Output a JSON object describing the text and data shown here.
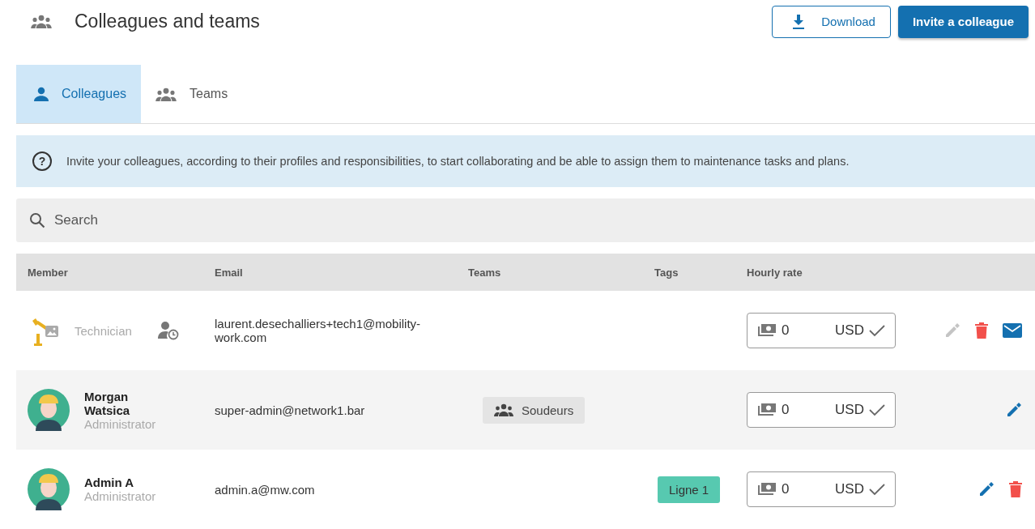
{
  "header": {
    "title": "Colleagues and teams",
    "download_button": "Download",
    "invite_button": "Invite a colleague"
  },
  "tabs": [
    {
      "label": "Colleagues",
      "kind": "person",
      "selected": true
    },
    {
      "label": "Teams",
      "kind": "group",
      "selected": false
    }
  ],
  "info_banner": {
    "icon": "?",
    "text": "Invite your colleagues, according to their profiles and responsibilities, to start collaborating and be able to assign them to maintenance tasks and plans."
  },
  "search": {
    "placeholder": "Search"
  },
  "table": {
    "columns": [
      "Member",
      "Email",
      "Teams",
      "Tags",
      "Hourly rate"
    ],
    "rows": [
      {
        "kind": "robot",
        "role": "Technician",
        "pending": true,
        "email": "laurent.desechalliers+tech1@mobility-work.com",
        "teams": [],
        "tags": [],
        "rate": "0",
        "currency": "USD",
        "actions": [
          {
            "kind": "edit",
            "disabled": true
          },
          {
            "kind": "delete"
          },
          {
            "kind": "mail"
          }
        ]
      },
      {
        "kind": "worker",
        "name": "Morgan Watsica",
        "role": "Administrator",
        "pending": false,
        "email": "super-admin@network1.bar",
        "teams": [
          "Soudeurs"
        ],
        "tags": [],
        "rate": "0",
        "currency": "USD",
        "actions": [
          {
            "kind": "edit",
            "disabled": false
          }
        ]
      },
      {
        "kind": "worker",
        "name": "Admin A",
        "role": "Administrator",
        "pending": false,
        "email": "admin.a@mw.com",
        "teams": [],
        "tags": [
          {
            "label": "Ligne 1",
            "color": "#57c9b0"
          }
        ],
        "rate": "0",
        "currency": "USD",
        "actions": [
          {
            "kind": "edit",
            "disabled": false
          },
          {
            "kind": "delete"
          }
        ]
      }
    ]
  }
}
